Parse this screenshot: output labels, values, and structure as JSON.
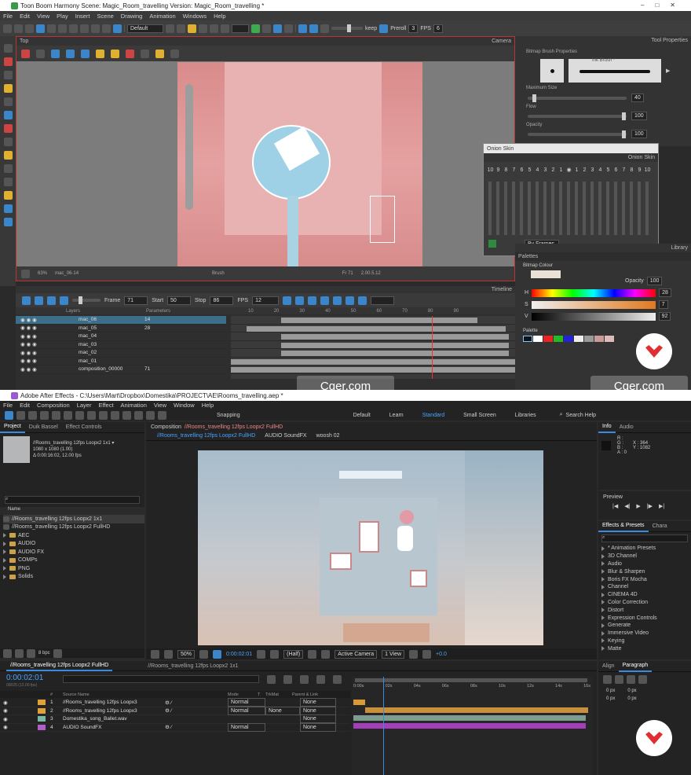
{
  "harmony": {
    "title": "Toon Boom Harmony Scene: Magic_Room_travelling Version: Magic_Room_travelling *",
    "menu": [
      "File",
      "Edit",
      "View",
      "Play",
      "Insert",
      "Scene",
      "Drawing",
      "Animation",
      "Windows",
      "Help"
    ],
    "workspace": "Default",
    "keep": "keep",
    "preroll_label": "Preroll",
    "preroll": "3",
    "fps_label": "FPS",
    "fps": "6",
    "view_tab": "Top",
    "camera_tab": "Camera",
    "status": {
      "zoom": "63%",
      "drawing": "mac_06-14",
      "tool": "Brush",
      "frame": "Fr 71",
      "coords": "2.00.5.12"
    },
    "tool_properties": {
      "tab": "Tool Properties",
      "section": "Bitmap Brush Properties",
      "preset": "Ink Brush *",
      "max_size_label": "Maximum Size",
      "max_size": "40",
      "flow_label": "Flow",
      "flow": "100",
      "opacity_label": "Opacity",
      "opacity": "100"
    },
    "onion": {
      "window": "Onion Skin",
      "tab": "Onion Skin",
      "numbers": [
        "10",
        "9",
        "8",
        "7",
        "6",
        "5",
        "4",
        "3",
        "2",
        "1",
        "",
        "1",
        "2",
        "3",
        "4",
        "5",
        "6",
        "7",
        "8",
        "9",
        "10"
      ],
      "mode": "By Frames"
    },
    "library_tab": "Library",
    "palettes_tab": "Palettes",
    "colour": {
      "title": "Bitmap Colour",
      "opacity_label": "Opacity",
      "opacity": "100",
      "h": "28",
      "s": "7",
      "v": "92",
      "h_label": "H",
      "s_label": "S",
      "v_label": "V",
      "palette": "Palette"
    },
    "timeline": {
      "tab": "Timeline",
      "frame_label": "Frame",
      "frame": "71",
      "start_label": "Start",
      "start": "50",
      "stop_label": "Stop",
      "stop": "86",
      "fps_label": "FPS",
      "fps": "12",
      "layers_hdr": "Layers",
      "params_hdr": "Parameters",
      "ruler": [
        "10",
        "20",
        "30",
        "40",
        "50",
        "60",
        "70",
        "80",
        "90"
      ],
      "layers": [
        {
          "name": "mac_06",
          "p": "14"
        },
        {
          "name": "mac_05",
          "p": "28"
        },
        {
          "name": "mac_04",
          "p": ""
        },
        {
          "name": "mac_03",
          "p": ""
        },
        {
          "name": "mac_02",
          "p": ""
        },
        {
          "name": "mac_01",
          "p": ""
        },
        {
          "name": "composition_00000",
          "p": "71"
        }
      ]
    }
  },
  "watermark": "Cger.com",
  "ae": {
    "title": "Adobe After Effects - C:\\Users\\Mart\\Dropbox\\Domestika\\PROJECT\\AE\\Rooms_travelling.aep *",
    "menu": [
      "File",
      "Edit",
      "Composition",
      "Layer",
      "Effect",
      "Animation",
      "View",
      "Window",
      "Help"
    ],
    "snapping": "Snapping",
    "workspaces": [
      "Default",
      "Learn",
      "Standard",
      "Small Screen",
      "Libraries"
    ],
    "search": "Search Help",
    "project": {
      "tab": "Project",
      "tab2": "Duik Bassel",
      "tab3": "Effect Controls",
      "comp": "//Rooms_travelling 12fps Loopx2 1x1 ▾",
      "info1": "1080 x 1080 (1.00)",
      "info2": "Δ 0:00:16:02, 12.00 fps",
      "name_hdr": "Name",
      "items": [
        "//Rooms_travelling 12fps Loopx2 1x1",
        "//Rooms_travelling 12fps Loopx2 FullHD",
        "AEC",
        "AUDIO",
        "AUDIO FX",
        "COMPs",
        "PNG",
        "Solids"
      ],
      "bpc": "8 bpc"
    },
    "comp": {
      "tab": "Composition",
      "name": "//Rooms_travelling 12fps Loopx2 FullHD",
      "sub_tabs": [
        "//Rooms_travelling 12fps Loopx2 FullHD",
        "AUDIO SoundFX",
        "woosh 02"
      ],
      "zoom": "50%",
      "time": "0:00:02:01",
      "res": "(Half)",
      "camera": "Active Camera",
      "view": "1 View",
      "offset": "+0.0"
    },
    "info": {
      "tab": "Info",
      "tab2": "Audio",
      "r": "R :",
      "g": "G :",
      "b": "B :",
      "a": "A : 0",
      "x": "X : 364",
      "y": "Y : 1082"
    },
    "preview": {
      "tab": "Preview"
    },
    "effects": {
      "tab": "Effects & Presets",
      "tab2": "Chara",
      "items": [
        "* Animation Presets",
        "3D Channel",
        "Audio",
        "Blur & Sharpen",
        "Boris FX Mocha",
        "Channel",
        "CINEMA 4D",
        "Color Correction",
        "Distort",
        "Expression Controls",
        "Generate",
        "Immersive Video",
        "Keying",
        "Matte"
      ]
    },
    "align": {
      "tab": "Align",
      "tab2": "Paragraph",
      "px": "0 px"
    },
    "timeline": {
      "tab1": "//Rooms_travelling 12fps Loopx2 FullHD",
      "tab2": "//Rooms_travelling 12fps Loopx2 1x1",
      "time": "0:00:02:01",
      "sub": "00025 (12.00 fps)",
      "hdr": {
        "num": "#",
        "src": "Source Name",
        "mode": "Mode",
        "t": "T",
        "trk": "TrkMat",
        "parent": "Parent & Link"
      },
      "ruler": [
        "0:00s",
        "02s",
        "04s",
        "06s",
        "08s",
        "10s",
        "12s",
        "14s",
        "16s"
      ],
      "layers": [
        {
          "n": "1",
          "name": "//Rooms_travelling 12fps Loopx3",
          "mode": "Normal",
          "trk": "",
          "parent": "None"
        },
        {
          "n": "2",
          "name": "//Rooms_travelling 12fps Loopx3",
          "mode": "Normal",
          "trk": "None",
          "parent": "None"
        },
        {
          "n": "3",
          "name": "Domestika_song_Ballet.wav",
          "mode": "",
          "trk": "",
          "parent": "None"
        },
        {
          "n": "4",
          "name": "AUDIO SoundFX",
          "mode": "Normal",
          "trk": "",
          "parent": "None"
        }
      ]
    }
  }
}
